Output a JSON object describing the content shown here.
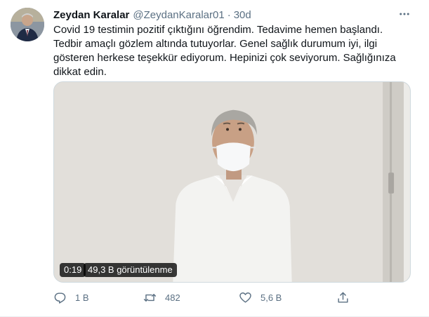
{
  "tweet": {
    "author_name": "Zeydan Karalar",
    "handle": "@ZeydanKaralar01",
    "separator": "·",
    "time": "30d",
    "text": "Covid 19 testimin pozitif çıktığını öğrendim. Tedavime hemen başlandı. Tedbir amaçlı gözlem altında tutuyorlar. Genel sağlık durumum iyi, ilgi gösteren herkese teşekkür ediyorum. Hepinizi çok seviyorum. Sağlığınıza dikkat edin."
  },
  "video": {
    "duration": "0:19",
    "views": "49,3 B görüntülenme"
  },
  "actions": {
    "reply_count": "1 B",
    "retweet_count": "482",
    "like_count": "5,6 B"
  },
  "icons": {
    "more": "more-horizontal-icon",
    "reply": "reply-icon",
    "retweet": "retweet-icon",
    "like": "heart-icon",
    "share": "share-icon"
  },
  "colors": {
    "text_primary": "#0f1419",
    "text_secondary": "#5b7083",
    "border": "#cfd9de"
  }
}
